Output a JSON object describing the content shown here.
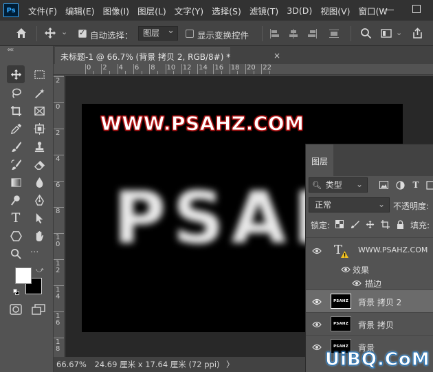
{
  "app": {
    "logo_text": "Ps",
    "menu": [
      "文件(F)",
      "编辑(E)",
      "图像(I)",
      "图层(L)",
      "文字(Y)",
      "选择(S)",
      "滤镜(T)",
      "3D(D)",
      "视图(V)",
      "窗口(W"
    ]
  },
  "options": {
    "auto_select_label": "自动选择：",
    "auto_select_checked": true,
    "auto_select_target": "图层",
    "show_transform_label": "显示变换控件",
    "show_transform_checked": false
  },
  "document": {
    "tab_title": "未标题-1 @ 66.7% (背景 拷贝 2, RGB/8#) *",
    "close_glyph": "×",
    "ruler_top_labels": [
      "0",
      "2",
      "4",
      "6",
      "8",
      "10",
      "12",
      "14",
      "16",
      "18",
      "20",
      "22"
    ],
    "ruler_left_labels": [
      "2",
      "0",
      "2",
      "4",
      "6",
      "8",
      "1\n0",
      "1\n2",
      "1\n4",
      "1\n6",
      "1\n8"
    ],
    "canvas_text_small": "WWW.PSAHZ.COM",
    "canvas_text_big": "PSAHZ"
  },
  "status": {
    "zoom": "66.67%",
    "doc_info": "24.69 厘米 x 17.64 厘米 (72 ppi)",
    "arrow": "〉"
  },
  "layers_panel": {
    "tab_label": "图层",
    "filter_kind": "类型",
    "blend_mode": "正常",
    "opacity_label": "不透明度:",
    "lock_label": "锁定:",
    "fill_label": "填充:",
    "layers": [
      {
        "name": "WWW.PSAHZ.COM",
        "kind": "text",
        "selected": false
      },
      {
        "name": "背景 拷贝 2",
        "kind": "pixel",
        "thumb_text": "PSAHZ",
        "selected": true
      },
      {
        "name": "背景 拷贝",
        "kind": "pixel",
        "thumb_text": "PSAHZ",
        "selected": false
      },
      {
        "name": "背景",
        "kind": "pixel",
        "thumb_text": "PSAHZ",
        "selected": false
      }
    ],
    "effects_label": "效果",
    "stroke_label": "描边"
  },
  "watermark": "UiBQ.CoM",
  "colors": {
    "menubar_bg": "#323232",
    "panel_bg": "#535353",
    "pasteboard": "#282828",
    "stroke_red": "#b3191a",
    "selected_row": "#6b6b6b"
  }
}
